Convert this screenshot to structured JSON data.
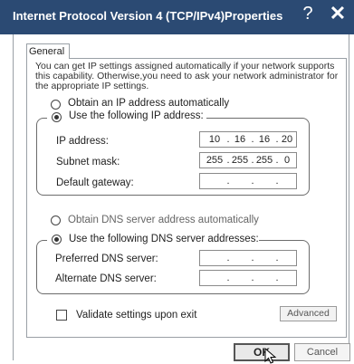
{
  "window": {
    "title": "Internet Protocol Version 4 (TCP/IPv4)Properties"
  },
  "titlebar": {
    "help_icon": "?",
    "close_icon": "✕"
  },
  "tabs": [
    {
      "label": "General"
    }
  ],
  "description": "You can get IP settings assigned automatically if your network supports this capability. Otherwise,you need to ask your network administrator for the appropriate IP settings.",
  "ip_section": {
    "auto_label": "Obtain an IP address automatically",
    "manual_label": "Use the following IP address:",
    "manual_selected": true,
    "fields": [
      {
        "label": "IP address:",
        "octets": [
          "10",
          "16",
          "16",
          "20"
        ]
      },
      {
        "label": "Subnet mask:",
        "octets": [
          "255",
          "255",
          "255",
          "0"
        ]
      },
      {
        "label": "Default gateway:",
        "octets": [
          "",
          "",
          "",
          ""
        ]
      }
    ]
  },
  "dns_section": {
    "auto_label": "Obtain DNS  server address automatically",
    "manual_label": "Use the following DNS server addresses:",
    "manual_selected": true,
    "fields": [
      {
        "label": "Preferred DNS server:",
        "octets": [
          "",
          "",
          "",
          ""
        ]
      },
      {
        "label": "Alternate DNS server:",
        "octets": [
          "",
          "",
          "",
          ""
        ]
      }
    ]
  },
  "validate": {
    "label": "Validate settings upon exit",
    "checked": false
  },
  "buttons": {
    "advanced": "Advanced",
    "ok": "OK",
    "cancel": "Cancel"
  },
  "colors": {
    "titlebar": "#2b4a73"
  }
}
